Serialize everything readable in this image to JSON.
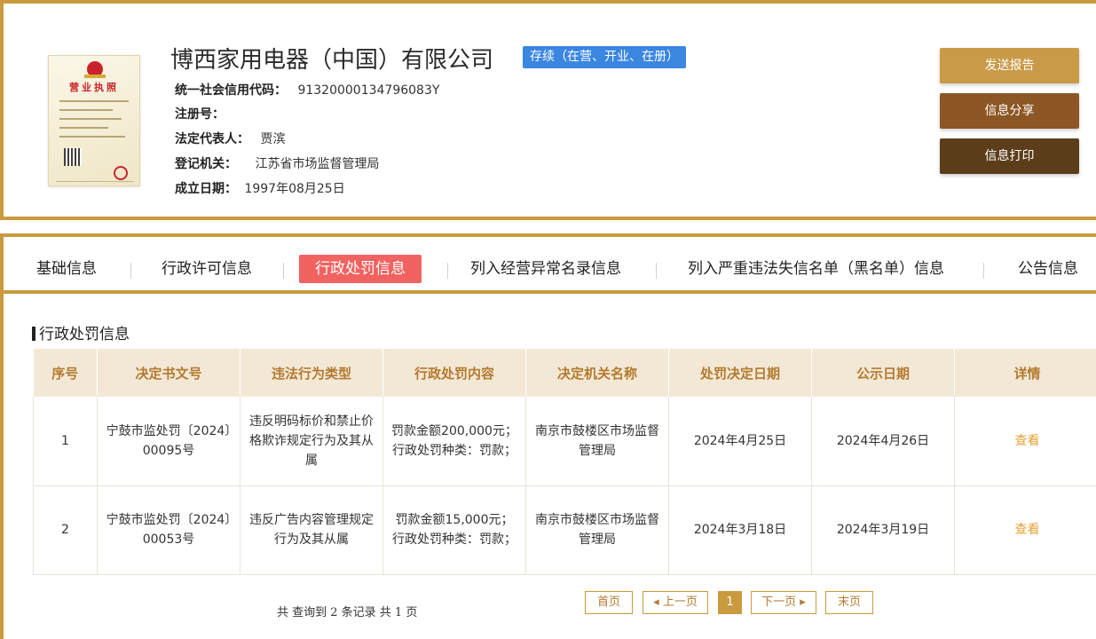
{
  "company": {
    "name": "博西家用电器（中国）有限公司",
    "status": "存续（在营、开业、在册）",
    "license_title": "营业执照",
    "fields": [
      {
        "label": "统一社会信用代码：",
        "value": "91320000134796083Y"
      },
      {
        "label": "注册号：",
        "value": ""
      },
      {
        "label": "法定代表人：",
        "value": "贾滨"
      },
      {
        "label": "登记机关：",
        "value": "江苏省市场监督管理局"
      },
      {
        "label": "成立日期：",
        "value": "1997年08月25日"
      }
    ]
  },
  "actions": {
    "send_report": "发送报告",
    "share": "信息分享",
    "print": "信息打印"
  },
  "colors": {
    "frame": "#c99a3e",
    "badge": "#3a86e0",
    "active_tab": "#f16360",
    "table_header_bg": "#f3e8d6",
    "table_header_text": "#b37a2e",
    "detail_link": "#e9a036"
  },
  "tabs": [
    {
      "label": "基础信息",
      "active": false
    },
    {
      "label": "行政许可信息",
      "active": false
    },
    {
      "label": "行政处罚信息",
      "active": true
    },
    {
      "label": "列入经营异常名录信息",
      "active": false
    },
    {
      "label": "列入严重违法失信名单（黑名单）信息",
      "active": false
    },
    {
      "label": "公告信息",
      "active": false
    }
  ],
  "section": {
    "title": "行政处罚信息"
  },
  "table": {
    "headers": [
      "序号",
      "决定书文号",
      "违法行为类型",
      "行政处罚内容",
      "决定机关名称",
      "处罚决定日期",
      "公示日期",
      "详情"
    ],
    "rows": [
      {
        "index": "1",
        "doc_no": "宁鼓市监处罚〔2024〕00095号",
        "type": "违反明码标价和禁止价格欺诈规定行为及其从属",
        "content": "罚款金额200,000元；行政处罚种类：罚款；",
        "authority": "南京市鼓楼区市场监督管理局",
        "decision_date": "2024年4月25日",
        "publish_date": "2024年4月26日",
        "detail": "查看"
      },
      {
        "index": "2",
        "doc_no": "宁鼓市监处罚〔2024〕00053号",
        "type": "违反广告内容管理规定行为及其从属",
        "content": "罚款金额15,000元；行政处罚种类：罚款；",
        "authority": "南京市鼓楼区市场监督管理局",
        "decision_date": "2024年3月18日",
        "publish_date": "2024年3月19日",
        "detail": "查看"
      }
    ]
  },
  "pagination": {
    "summary": "共 查询到 2 条记录 共 1 页",
    "first": "首页",
    "prev": "◂ 上一页",
    "current": "1",
    "next": "下一页 ▸",
    "last": "末页"
  }
}
